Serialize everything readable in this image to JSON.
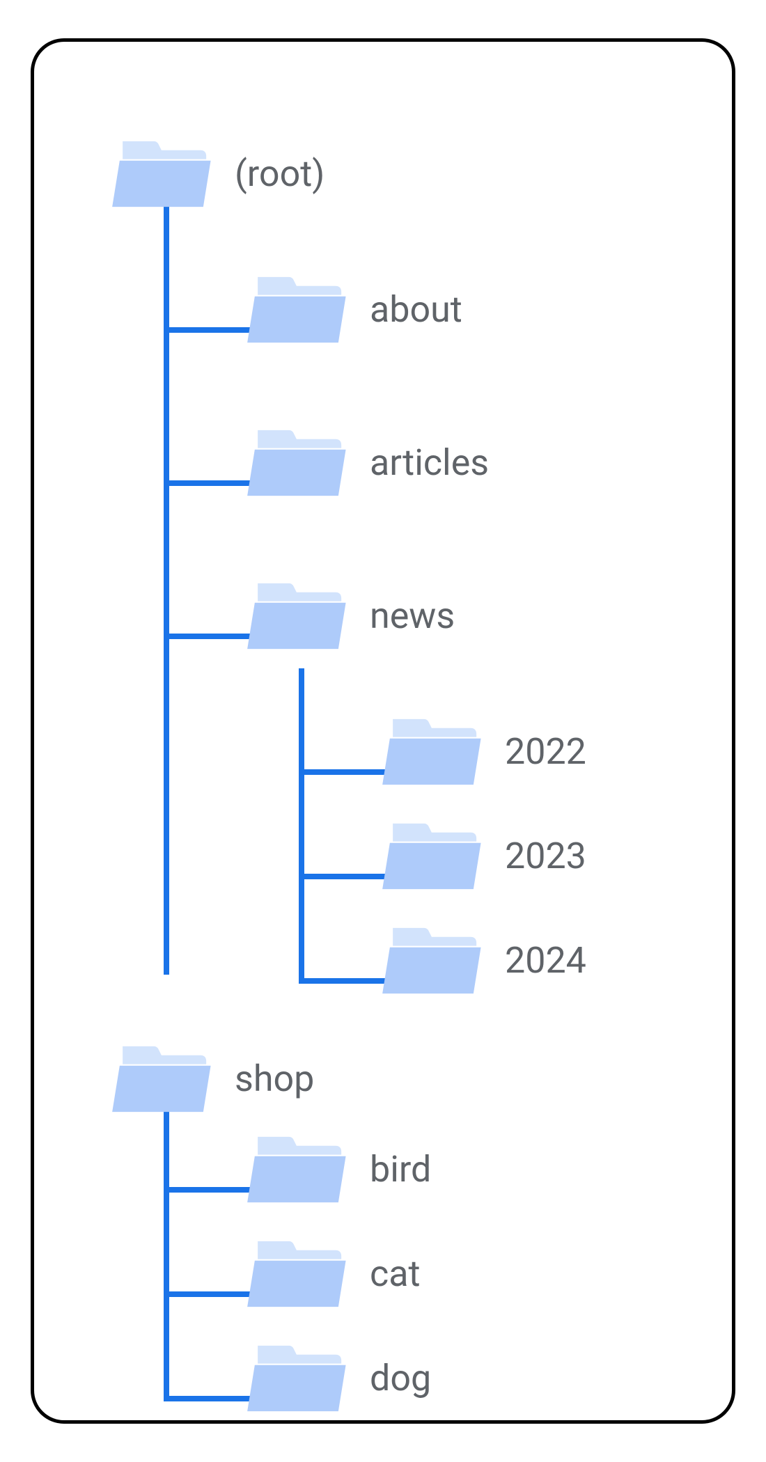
{
  "colors": {
    "line": "#1a73e8",
    "folder_light": "#d2e3fc",
    "folder_main": "#aecbfa",
    "label": "#5f6368"
  },
  "tree": {
    "root": {
      "label": "(root)"
    },
    "about": {
      "label": "about"
    },
    "articles": {
      "label": "articles"
    },
    "news": {
      "label": "news"
    },
    "news_children": {
      "y2022": {
        "label": "2022"
      },
      "y2023": {
        "label": "2023"
      },
      "y2024": {
        "label": "2024"
      }
    },
    "shop": {
      "label": "shop"
    },
    "shop_children": {
      "bird": {
        "label": "bird"
      },
      "cat": {
        "label": "cat"
      },
      "dog": {
        "label": "dog"
      }
    }
  }
}
